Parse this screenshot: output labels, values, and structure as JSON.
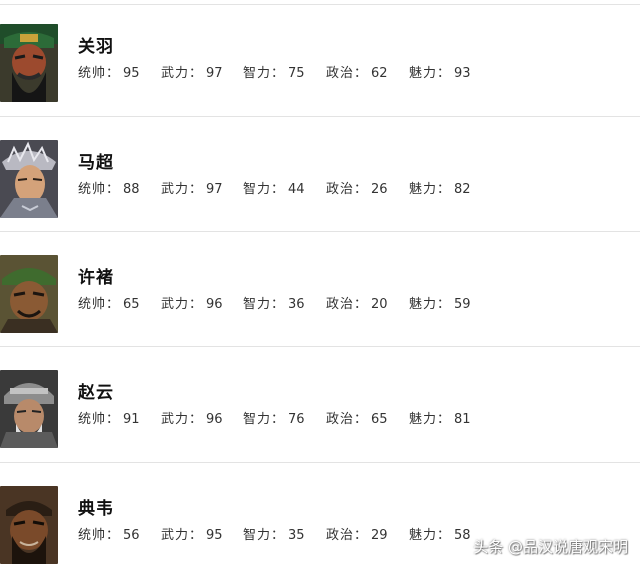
{
  "generals": [
    {
      "name": "关羽",
      "stats": [
        {
          "label": "统帅",
          "value": "95"
        },
        {
          "label": "武力",
          "value": "97"
        },
        {
          "label": "智力",
          "value": "75"
        },
        {
          "label": "政治",
          "value": "62"
        },
        {
          "label": "魅力",
          "value": "93"
        }
      ],
      "portrait": "guan-yu-portrait"
    },
    {
      "name": "马超",
      "stats": [
        {
          "label": "统帅",
          "value": "88"
        },
        {
          "label": "武力",
          "value": "97"
        },
        {
          "label": "智力",
          "value": "44"
        },
        {
          "label": "政治",
          "value": "26"
        },
        {
          "label": "魅力",
          "value": "82"
        }
      ],
      "portrait": "ma-chao-portrait"
    },
    {
      "name": "许褚",
      "stats": [
        {
          "label": "统帅",
          "value": "65"
        },
        {
          "label": "武力",
          "value": "96"
        },
        {
          "label": "智力",
          "value": "36"
        },
        {
          "label": "政治",
          "value": "20"
        },
        {
          "label": "魅力",
          "value": "59"
        }
      ],
      "portrait": "xu-chu-portrait"
    },
    {
      "name": "赵云",
      "stats": [
        {
          "label": "统帅",
          "value": "91"
        },
        {
          "label": "武力",
          "value": "96"
        },
        {
          "label": "智力",
          "value": "76"
        },
        {
          "label": "政治",
          "value": "65"
        },
        {
          "label": "魅力",
          "value": "81"
        }
      ],
      "portrait": "zhao-yun-portrait"
    },
    {
      "name": "典韦",
      "stats": [
        {
          "label": "统帅",
          "value": "56"
        },
        {
          "label": "武力",
          "value": "95"
        },
        {
          "label": "智力",
          "value": "35"
        },
        {
          "label": "政治",
          "value": "29"
        },
        {
          "label": "魅力",
          "value": "58"
        }
      ],
      "portrait": "dian-wei-portrait"
    }
  ],
  "separator": "：",
  "watermark": "头条 @品汉说唐观宋明"
}
